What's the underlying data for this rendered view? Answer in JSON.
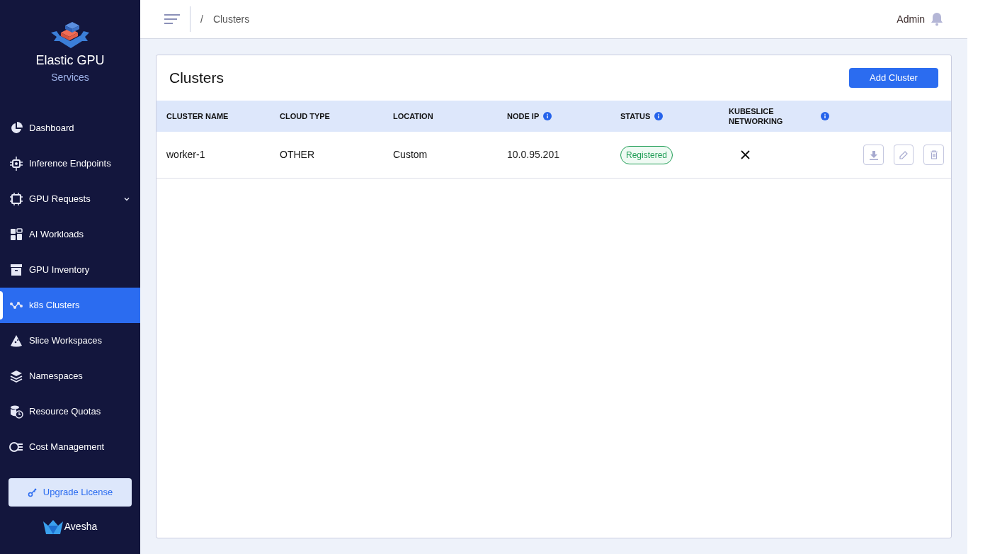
{
  "brand": {
    "title": "Elastic GPU",
    "subtitle": "Services"
  },
  "nav": [
    {
      "label": "Dashboard",
      "kind": "pie",
      "selected": false
    },
    {
      "label": "Inference Endpoints",
      "kind": "chip-gear",
      "selected": false
    },
    {
      "label": "GPU Requests",
      "kind": "chip",
      "selected": false,
      "expandable": true
    },
    {
      "label": "AI Workloads",
      "kind": "grid",
      "selected": false
    },
    {
      "label": "GPU Inventory",
      "kind": "archive",
      "selected": false
    },
    {
      "label": "k8s Clusters",
      "kind": "nodes",
      "selected": true
    },
    {
      "label": "Slice Workspaces",
      "kind": "slice",
      "selected": false
    },
    {
      "label": "Namespaces",
      "kind": "layers",
      "selected": false
    },
    {
      "label": "Resource Quotas",
      "kind": "db-clock",
      "selected": false
    },
    {
      "label": "Cost Management",
      "kind": "coins",
      "selected": false
    }
  ],
  "upgrade_button": "Upgrade License",
  "footer_logo": "Avesha",
  "breadcrumb": {
    "separator": "/",
    "current": "Clusters"
  },
  "user": "Admin",
  "page": {
    "title": "Clusters",
    "add_button": "Add Cluster"
  },
  "table": {
    "columns": [
      {
        "label": "CLUSTER NAME",
        "info": false
      },
      {
        "label": "CLOUD TYPE",
        "info": false
      },
      {
        "label": "LOCATION",
        "info": false
      },
      {
        "label": "NODE IP",
        "info": true
      },
      {
        "label": "STATUS",
        "info": true
      },
      {
        "label": "KUBESLICE NETWORKING",
        "info": true
      }
    ],
    "rows": [
      {
        "name": "worker-1",
        "cloud_type": "OTHER",
        "location": "Custom",
        "node_ip": "10.0.95.201",
        "status": "Registered",
        "kubeslice_networking": false
      }
    ]
  }
}
